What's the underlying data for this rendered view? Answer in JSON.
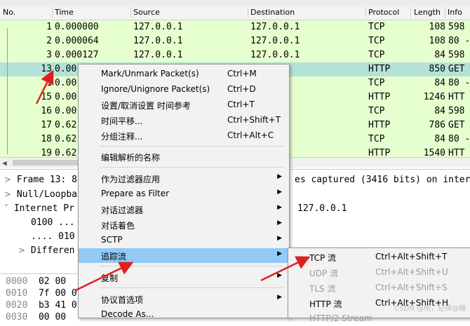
{
  "columns": {
    "no": "No.",
    "time": "Time",
    "source": "Source",
    "destination": "Destination",
    "protocol": "Protocol",
    "length": "Length",
    "info": "Info"
  },
  "packets": [
    {
      "no": "1",
      "time": "0.000000",
      "source": "127.0.0.1",
      "destination": "127.0.0.1",
      "protocol": "TCP",
      "length": "108",
      "info": "598"
    },
    {
      "no": "2",
      "time": "0.000064",
      "source": "127.0.0.1",
      "destination": "127.0.0.1",
      "protocol": "TCP",
      "length": "108",
      "info": "80 -"
    },
    {
      "no": "3",
      "time": "0.000127",
      "source": "127.0.0.1",
      "destination": "127.0.0.1",
      "protocol": "TCP",
      "length": "84",
      "info": "598"
    },
    {
      "no": "13",
      "time": "0.00",
      "source": "",
      "destination": ".1",
      "protocol": "HTTP",
      "length": "850",
      "info": "GET"
    },
    {
      "no": "1",
      "time": "0.00",
      "source": "",
      "destination": ".1",
      "protocol": "TCP",
      "length": "84",
      "info": "80 -"
    },
    {
      "no": "15",
      "time": "0.00",
      "source": "",
      "destination": ".1",
      "protocol": "HTTP",
      "length": "1246",
      "info": "HTT"
    },
    {
      "no": "16",
      "time": "0.00",
      "source": "",
      "destination": ".1",
      "protocol": "TCP",
      "length": "84",
      "info": "598"
    },
    {
      "no": "17",
      "time": "0.62",
      "source": "",
      "destination": ".1",
      "protocol": "HTTP",
      "length": "786",
      "info": "GET"
    },
    {
      "no": "18",
      "time": "0.62",
      "source": "",
      "destination": ".1",
      "protocol": "TCP",
      "length": "84",
      "info": "80 -"
    },
    {
      "no": "19",
      "time": "0.62",
      "source": "",
      "destination": ".1",
      "protocol": "HTTP",
      "length": "1540",
      "info": "HTT"
    }
  ],
  "details": [
    {
      "left": "Frame 13: 8",
      "right": "es captured (3416 bits) on inter"
    },
    {
      "left": "Null/Loopba",
      "right": ""
    },
    {
      "left": "Internet Pr",
      "right": "127.0.0.1"
    },
    {
      "left": "0100 ...",
      "right": ""
    },
    {
      "left": ".... 010",
      "right": ""
    },
    {
      "left": "Differen",
      "right": ""
    }
  ],
  "hex": [
    {
      "offset": "0000",
      "bytes": "02 00"
    },
    {
      "offset": "0010",
      "bytes": "7f 00 0"
    },
    {
      "offset": "0020",
      "bytes": "b3 41 0"
    },
    {
      "offset": "0030",
      "bytes": "00 00"
    }
  ],
  "menu": [
    {
      "label": "Mark/Unmark Packet(s)",
      "shortcut": "Ctrl+M"
    },
    {
      "label": "Ignore/Unignore Packet(s)",
      "shortcut": "Ctrl+D"
    },
    {
      "label": "设置/取消设置 时间参考",
      "shortcut": "Ctrl+T"
    },
    {
      "label": "时间平移...",
      "shortcut": "Ctrl+Shift+T"
    },
    {
      "label": "分组注释...",
      "shortcut": "Ctrl+Alt+C"
    },
    {
      "label": "编辑解析的名称",
      "shortcut": ""
    },
    {
      "label": "作为过滤器应用",
      "shortcut": ""
    },
    {
      "label": "Prepare as Filter",
      "shortcut": ""
    },
    {
      "label": "对话过滤器",
      "shortcut": ""
    },
    {
      "label": "对话着色",
      "shortcut": ""
    },
    {
      "label": "SCTP",
      "shortcut": ""
    },
    {
      "label": "追踪流",
      "shortcut": ""
    },
    {
      "label": "复制",
      "shortcut": ""
    },
    {
      "label": "协议首选项",
      "shortcut": ""
    },
    {
      "label": "Decode As...",
      "shortcut": ""
    }
  ],
  "submenu": [
    {
      "label": "TCP 流",
      "shortcut": "Ctrl+Alt+Shift+T"
    },
    {
      "label": "UDP 流",
      "shortcut": "Ctrl+Alt+Shift+U"
    },
    {
      "label": "TLS 流",
      "shortcut": "Ctrl+Alt+Shift+S"
    },
    {
      "label": "HTTP 流",
      "shortcut": "Ctrl+Alt+Shift+H"
    },
    {
      "label": "HTTP/2 Stream",
      "shortcut": ""
    }
  ],
  "watermark": "CSDN @所，记得@鲤",
  "colors": {
    "row_bg": "#e6ffcf",
    "selected_bg": "#b4e2d6",
    "menu_highlight": "#91c9f7",
    "arrow": "#e02020"
  }
}
